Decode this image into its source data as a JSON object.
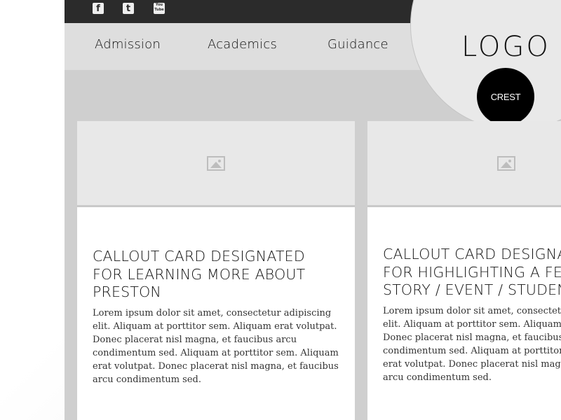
{
  "social": [
    {
      "icon": "facebook-icon",
      "label": "f"
    },
    {
      "icon": "twitter-icon",
      "label": "t"
    },
    {
      "icon": "youtube-icon",
      "label": "You Tube"
    }
  ],
  "nav": {
    "items": [
      "Admission",
      "Academics",
      "Guidance"
    ]
  },
  "logo": "LOGO",
  "crest": "CREST",
  "cards": [
    {
      "title": "CALLOUT CARD DESIGNATED\nFOR LEARNING MORE ABOUT\nPRESTON",
      "body": "Lorem ipsum dolor sit amet, consectetur adipiscing\nelit. Aliquam at porttitor sem. Aliquam erat volutpat.\nDonec placerat nisl magna, et faucibus arcu\ncondimentum sed. Aliquam at porttitor sem. Aliquam\nerat volutpat. Donec placerat nisl magna, et faucibus\narcu condimentum sed."
    },
    {
      "title": "CALLOUT CARD DESIGNA\nFOR HIGHLIGHTING A FEA\nSTORY / EVENT / STUDEN",
      "body": "Lorem ipsum dolor sit amet, consectetu\nelit. Aliquam at porttitor sem. Aliquam e\nDonec placerat nisl magna, et faucibus a\ncondimentum sed. Aliquam at porttitor \nerat volutpat. Donec placerat nisl magn\narcu condimentum sed."
    }
  ]
}
